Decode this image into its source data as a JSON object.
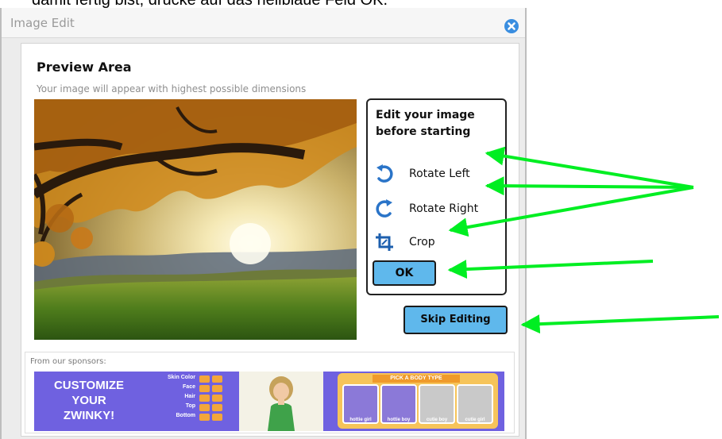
{
  "caption": "damit fertig bist, drücke auf das hellblaue Feld OK.",
  "dialog": {
    "title": "Image Edit",
    "preview_title": "Preview Area",
    "preview_subtitle": "Your image will appear with highest possible dimensions",
    "edit_heading": "Edit your image before starting",
    "tools": {
      "rotate_left": "Rotate Left",
      "rotate_right": "Rotate Right",
      "crop": "Crop"
    },
    "ok_label": "OK",
    "skip_label": "Skip Editing",
    "sponsor_label": "From our sponsors:"
  },
  "ad": {
    "headline_1": "CUSTOMIZE",
    "headline_2": "YOUR",
    "headline_3": "ZWINKY!",
    "options": [
      "Skin Color",
      "Face",
      "Hair",
      "Top",
      "Bottom"
    ],
    "pick_label": "PICK A BODY TYPE",
    "body_types": [
      "hottie girl",
      "hottie boy",
      "cutie boy",
      "cutie girl"
    ]
  },
  "colors": {
    "button": "#5fb8ec",
    "arrow": "#00ee22",
    "ad_bg": "#6f61e0"
  }
}
